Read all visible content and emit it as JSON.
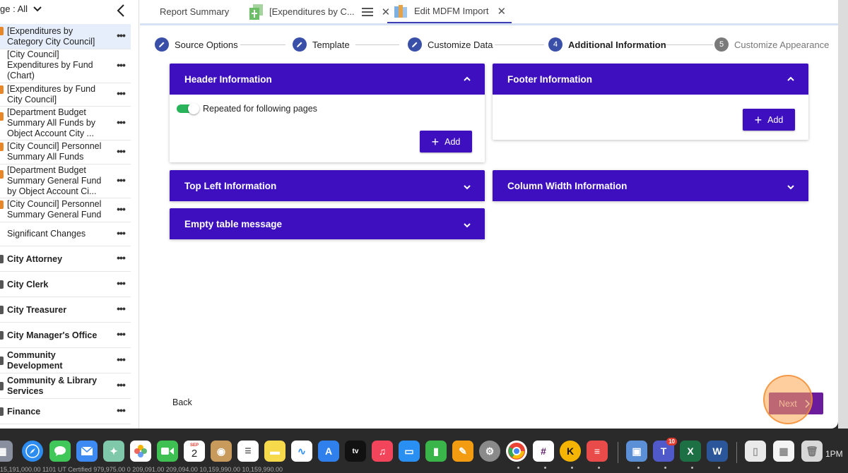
{
  "sidebar": {
    "page_filter": "ge : All",
    "items": [
      {
        "label": "[Expenditures by Category City Council]",
        "bold": false
      },
      {
        "label": "[City Council] Expenditures by Fund (Chart)",
        "bold": false
      },
      {
        "label": "[Expenditures by Fund City Council]",
        "bold": false
      },
      {
        "label": "[Department Budget Summary All Funds by Object Account City ...",
        "bold": false
      },
      {
        "label": "[City Council] Personnel Summary All Funds",
        "bold": false
      },
      {
        "label": "[Department Budget Summary General Fund by Object Account Ci...",
        "bold": false
      },
      {
        "label": "[City Council] Personnel Summary General Fund",
        "bold": false
      },
      {
        "label": "Significant Changes",
        "bold": false
      },
      {
        "label": "City Attorney",
        "bold": true
      },
      {
        "label": "City Clerk",
        "bold": true
      },
      {
        "label": "City Treasurer",
        "bold": true
      },
      {
        "label": "City Manager's Office",
        "bold": true
      },
      {
        "label": "Community Development",
        "bold": true
      },
      {
        "label": "Community & Library Services",
        "bold": true
      },
      {
        "label": "Finance",
        "bold": true
      }
    ],
    "more_label": "•••"
  },
  "tabs": [
    {
      "label": "Report Summary"
    },
    {
      "label": "[Expenditures by C...",
      "close": "✕"
    },
    {
      "label": "Edit MDFM Import",
      "close": "✕"
    }
  ],
  "stepper": {
    "steps": [
      {
        "label": "Source Options",
        "icon": "pencil-icon"
      },
      {
        "label": "Template",
        "icon": "pencil-icon"
      },
      {
        "label": "Customize Data",
        "icon": "pencil-icon"
      },
      {
        "number": "4",
        "label": "Additional Information"
      },
      {
        "number": "5",
        "label": "Customize Appearance"
      }
    ]
  },
  "panels": {
    "header": {
      "title": "Header Information",
      "toggle_label": "Repeated for following pages",
      "toggle_on": true,
      "add_label": "Add"
    },
    "footer": {
      "title": "Footer Information",
      "add_label": "Add"
    },
    "top_left": {
      "title": "Top Left Information"
    },
    "column_width": {
      "title": "Column Width Information"
    },
    "empty_table": {
      "title": "Empty table message"
    }
  },
  "footer_nav": {
    "back_label": "Back",
    "next_label": "Next"
  },
  "system": {
    "clock": "1PM",
    "calendar_month": "SEP",
    "calendar_day": "2",
    "teams_badge": "10"
  },
  "dock_bottom_text": "15,191,000.00        1101 UT Certified        979,975.00              0              209,091.00          209,094.00        10,159,990.00          10,159,990.00",
  "colors": {
    "primary": "#3d0fbf",
    "stepper": "#3a4fa8",
    "toggle": "#29b35a",
    "next": "#6b1c9d"
  }
}
